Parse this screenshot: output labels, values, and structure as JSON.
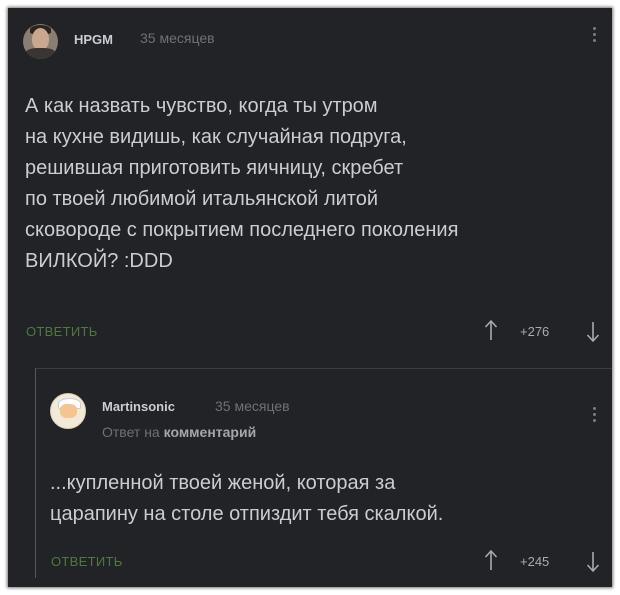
{
  "comment": {
    "author": "HPGM",
    "time": "35 месяцев",
    "lines": [
      "А как назвать чувство, когда ты утром",
      "на кухне видишь, как случайная подруга,",
      "решившая приготовить яичницу, скребет",
      "по твоей любимой итальянской литой",
      "сковороде с покрытием последнего поколения",
      "ВИЛКОЙ? :DDD"
    ],
    "reply_label": "ОТВЕТИТЬ",
    "score": "+276",
    "avatar_icon": "user-avatar-photo",
    "menu_icon": "vertical-dots-menu-icon"
  },
  "reply": {
    "author": "Martinsonic",
    "time": "35 месяцев",
    "reply_to_prefix": "Ответ на",
    "reply_to_link": "комментарий",
    "lines": [
      "...купленной твоей женой, которая за",
      "царапину на столе отпиздит тебя скалкой."
    ],
    "reply_label": "ОТВЕТИТЬ",
    "score": "+245",
    "avatar_icon": "user-avatar-chef",
    "menu_icon": "vertical-dots-menu-icon"
  },
  "colors": {
    "background": "#222326",
    "text": "#c9cdd3",
    "reply_green": "#4f7741",
    "muted": "#6d7178"
  }
}
